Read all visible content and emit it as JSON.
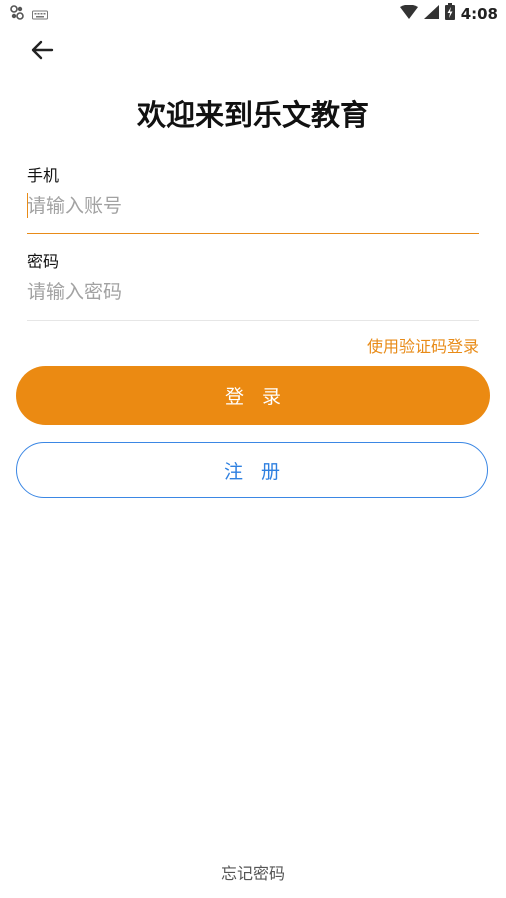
{
  "status_bar": {
    "time": "4:08",
    "left_icons": [
      "notification-app-icon",
      "keyboard-icon"
    ],
    "right_icons": [
      "wifi-icon",
      "signal-icon",
      "battery-charging-icon"
    ]
  },
  "header": {
    "back_icon": "arrow-left-icon",
    "title": "欢迎来到乐文教育"
  },
  "form": {
    "phone_label": "手机",
    "phone_placeholder": "请输入账号",
    "phone_value": "",
    "password_label": "密码",
    "password_placeholder": "请输入密码",
    "password_value": "",
    "sms_login_link": "使用验证码登录"
  },
  "actions": {
    "login_label": "登录",
    "register_label": "注册",
    "forgot_password": "忘记密码"
  },
  "colors": {
    "accent": "#eb8a12",
    "register_blue": "#2f80e0",
    "active_underline": "#e88b18",
    "inactive_underline": "#e6e6e6"
  }
}
